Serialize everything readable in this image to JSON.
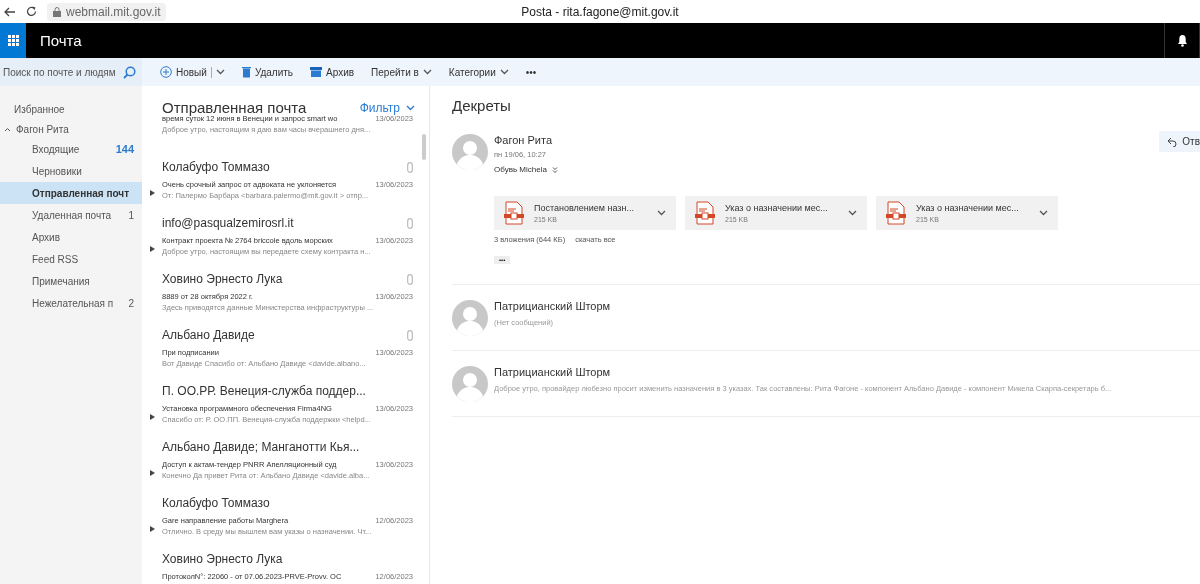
{
  "browser": {
    "url": "webmail.mit.gov.it",
    "title": "Posta - rita.fagone@mit.gov.it"
  },
  "app": {
    "title": "Почта"
  },
  "search": {
    "placeholder": "Поиск по почте и людям"
  },
  "toolbar": [
    {
      "label": "Новый",
      "kind": "new"
    },
    {
      "label": "Удалить",
      "kind": "delete"
    },
    {
      "label": "Архив",
      "kind": "archive"
    },
    {
      "label": "Перейти в",
      "kind": "menu"
    },
    {
      "label": "Категории",
      "kind": "menu"
    },
    {
      "label": "•••",
      "kind": "more"
    }
  ],
  "sidebar": {
    "favorites": "Избранное",
    "account": {
      "label": "Фагон Рита",
      "expanded": true
    },
    "folders": [
      {
        "label": "Входящие",
        "count": "144",
        "unread": true,
        "selected": false
      },
      {
        "label": "Черновики",
        "selected": false
      },
      {
        "label": "Отправленная почт",
        "selected": true
      },
      {
        "label": "Удаленная почта",
        "count": "1",
        "unread": false,
        "selected": false
      },
      {
        "label": "Архив",
        "selected": false
      },
      {
        "label": "Feed RSS",
        "selected": false
      },
      {
        "label": "Примечания",
        "selected": false
      },
      {
        "label": "Нежелательная п",
        "count": "2",
        "unread": false,
        "selected": false
      }
    ]
  },
  "list": {
    "title": "Отправленная почта",
    "filter": "Фильтр",
    "partial": {
      "subject": "время суток 12 июня в Венеции и запрос smart wo",
      "date": "13/06/2023",
      "preview": "Доброе утро, настоящим я даю вам часы вчерашнего дня..."
    },
    "messages": [
      {
        "sender": "Колабуфо Томмазо",
        "subject": "Очень срочный запрос от адвоката не уклоняется",
        "date": "13/06/2023",
        "preview": "От: Палермо Барбара <barbara.palermo@mit.gov.it > отпр...",
        "attachment": true,
        "thread": true
      },
      {
        "sender": "info@pasqualzemirosrl.it",
        "subject": "Контракт проекта № 2764 briccole вдоль морских",
        "date": "13/06/2023",
        "preview": "Доброе утро, настоящим вы передаете схему контракта н...",
        "attachment": true,
        "thread": true
      },
      {
        "sender": "Ховино Эрнесто Лука",
        "subject": "8889 от 28 октября 2022 г.",
        "date": "13/06/2023",
        "preview": "Здесь приводятся данные Министерства инфраструктуры ...",
        "attachment": true,
        "thread": false
      },
      {
        "sender": "Альбано Давиде",
        "subject": "При подписании",
        "date": "13/06/2023",
        "preview": "Вот Давиде Спасибо от: Альбано Давиде <davide.albano...",
        "attachment": true,
        "thread": false
      },
      {
        "sender": "П. ОО.РР. Венеция-служба поддер...",
        "subject": "Установка программного обеспечения Firma4NG",
        "date": "13/06/2023",
        "preview": "Спасибо от: Р. ОО.ПП. Венеция-служба поддержки <helpd...",
        "attachment": false,
        "thread": true
      },
      {
        "sender": "Альбано Давиде; Манганотти Кья...",
        "subject": "Доступ к актам-тендер PNRR Апелляционный суд",
        "date": "13/06/2023",
        "preview": "Конечно Да привет Рита от: Альбано Давиде <davide.alba...",
        "attachment": false,
        "thread": true
      },
      {
        "sender": "Колабуфо Томмазо",
        "subject": "Gare направление работы Marghera",
        "date": "12/06/2023",
        "preview": "Отлично. В среду мы вышлем вам указы о назначении. Чт...",
        "attachment": false,
        "thread": true
      },
      {
        "sender": "Ховино Эрнесто Лука",
        "subject": "ПротоколN°: 22060 - от 07.06.2023-PRVE-Provv. OC",
        "date": "12/06/2023",
        "attachment": false,
        "thread": false
      }
    ]
  },
  "reading": {
    "title": "Декреты",
    "reply": "Отв",
    "first": {
      "sender": "Фагон Рита",
      "date": "пн 19/06, 10:27",
      "to": "Обувь Michela",
      "attachments": [
        {
          "name": "Постановлением назн...",
          "size": "215 KB"
        },
        {
          "name": "Указ о назначении мес...",
          "size": "215 KB"
        },
        {
          "name": "Указ о назначении мес...",
          "size": "215 KB"
        }
      ],
      "summary": "3 вложения (644 КБ)",
      "download": "скачать все",
      "more": "•••"
    },
    "others": [
      {
        "sender": "Патрицианский Шторм",
        "preview": "(Нет сообщений)"
      },
      {
        "sender": "Патрицианский Шторм",
        "preview": "Доброе утро, провайдер любезно просит изменить назначения в 3 указах. Так составлены: Рита Фагоне - компонент Альбано Давиде - компонент Микела Скарпа-секретарь б..."
      }
    ]
  }
}
